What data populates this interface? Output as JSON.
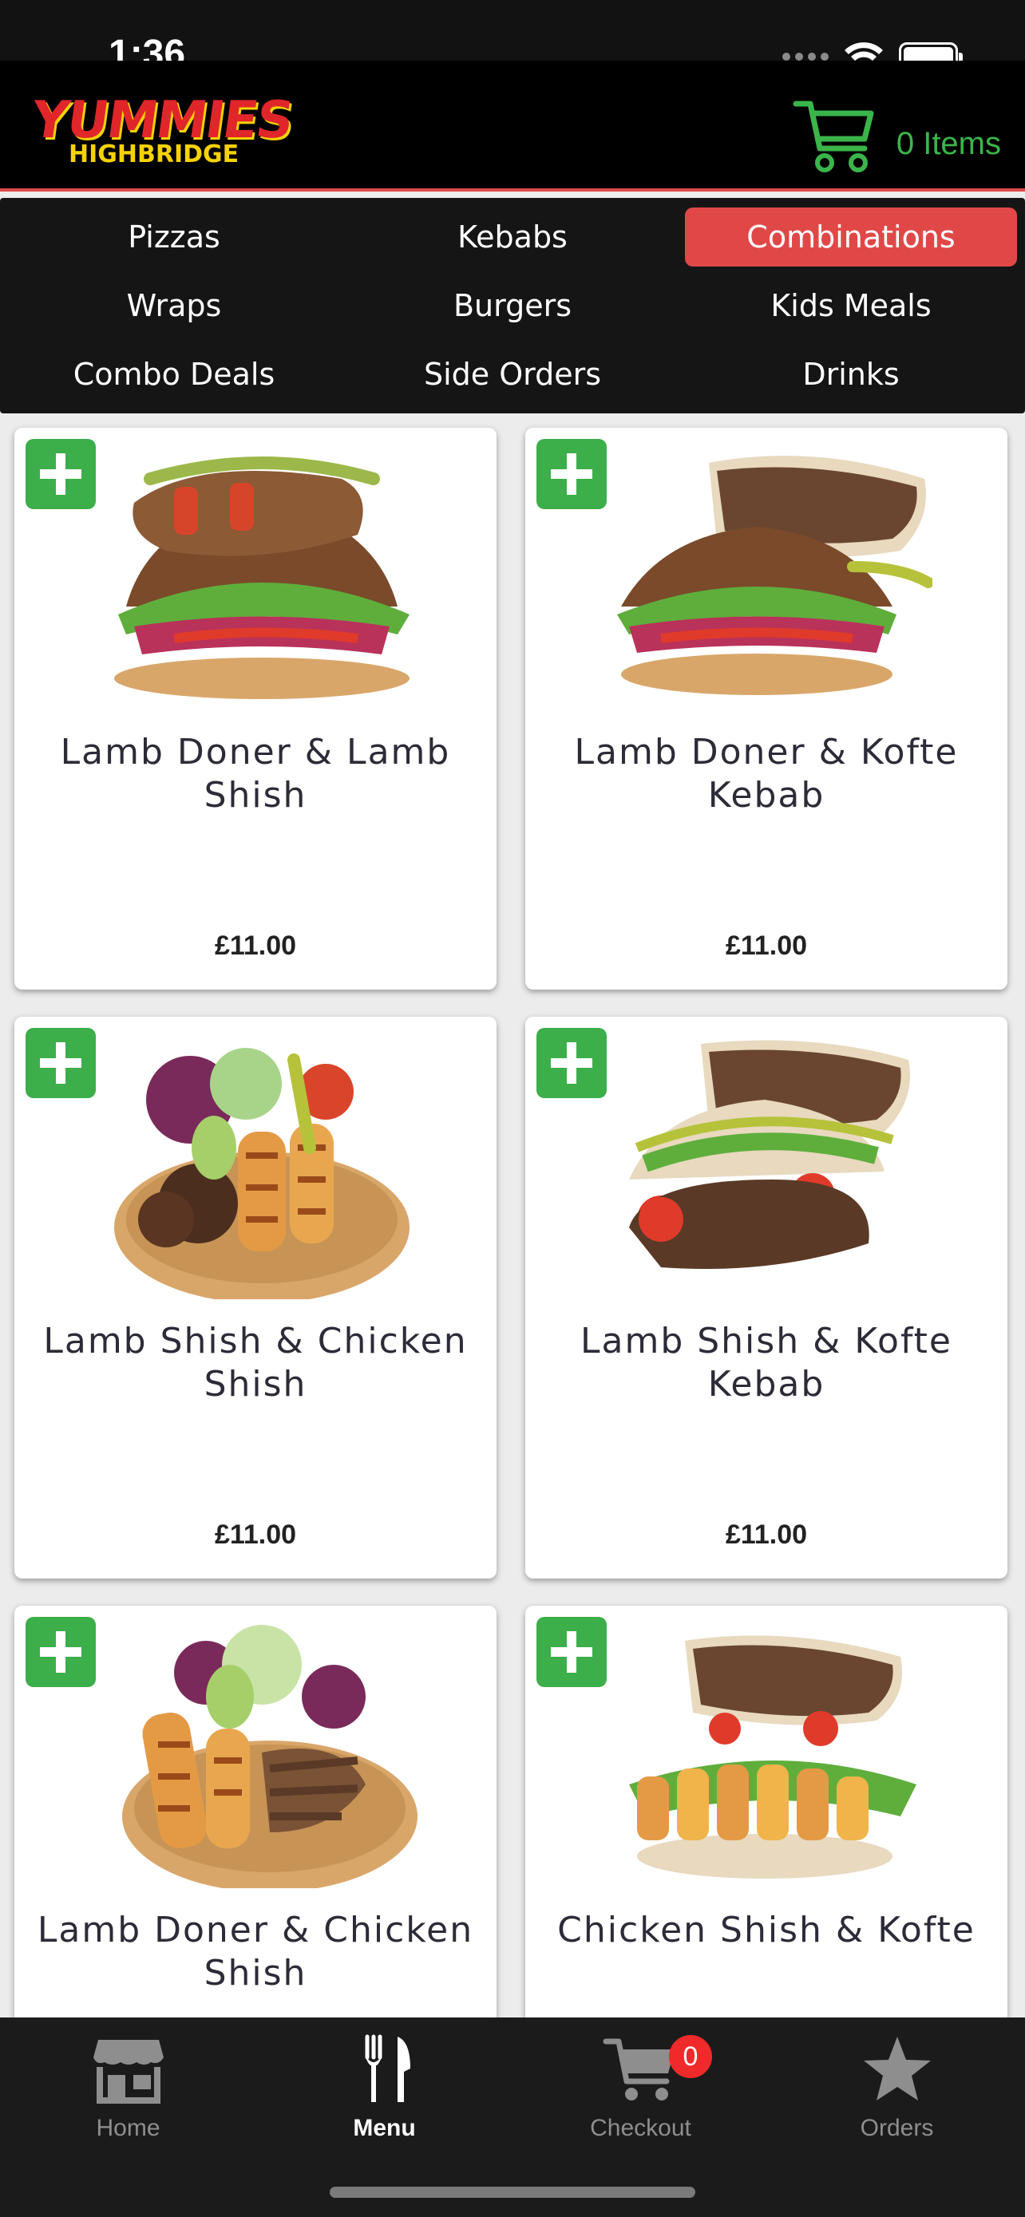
{
  "status_bar": {
    "time": "1:36"
  },
  "header": {
    "logo_line1": "YUMMIES",
    "logo_line2": "HIGHBRIDGE",
    "cart_label": "0 Items"
  },
  "categories": [
    {
      "label": "Pizzas",
      "active": false
    },
    {
      "label": "Kebabs",
      "active": false
    },
    {
      "label": "Combinations",
      "active": true
    },
    {
      "label": "Wraps",
      "active": false
    },
    {
      "label": "Burgers",
      "active": false
    },
    {
      "label": "Kids Meals",
      "active": false
    },
    {
      "label": "Combo Deals",
      "active": false
    },
    {
      "label": "Side Orders",
      "active": false
    },
    {
      "label": "Drinks",
      "active": false
    }
  ],
  "products": [
    {
      "name": "Lamb Doner & Lamb Shish",
      "price": "£11.00"
    },
    {
      "name": "Lamb Doner & Kofte Kebab",
      "price": "£11.00"
    },
    {
      "name": "Lamb Shish & Chicken Shish",
      "price": "£11.00"
    },
    {
      "name": "Lamb Shish & Kofte Kebab",
      "price": "£11.00"
    },
    {
      "name": "Lamb Doner & Chicken Shish",
      "price": ""
    },
    {
      "name": "Chicken Shish & Kofte",
      "price": ""
    }
  ],
  "tabbar": {
    "items": [
      {
        "label": "Home",
        "icon": "store-icon"
      },
      {
        "label": "Menu",
        "icon": "fork-knife-icon"
      },
      {
        "label": "Checkout",
        "icon": "cart-icon"
      },
      {
        "label": "Orders",
        "icon": "star-icon"
      }
    ],
    "checkout_badge": "0"
  },
  "colors": {
    "accent_red": "#e04848",
    "add_green": "#3cae4a",
    "cart_green": "#3ab54a",
    "badge_red": "#f02a2a"
  }
}
